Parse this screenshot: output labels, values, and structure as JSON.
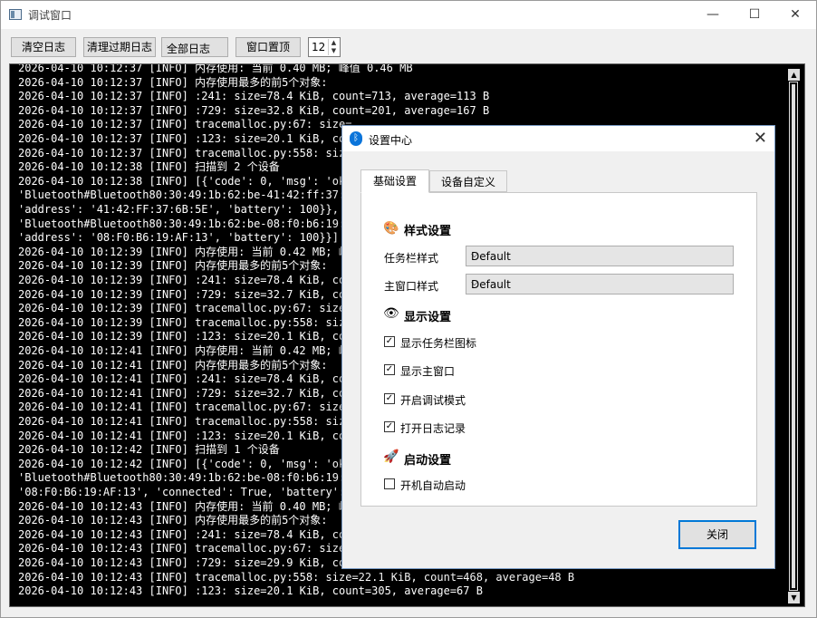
{
  "window": {
    "title": "调试窗口",
    "min": "—",
    "max": "☐",
    "close": "✕"
  },
  "toolbar": {
    "clear_log": "清空日志",
    "clear_expired": "清理过期日志",
    "filter_value": "全部日志",
    "pin_top": "窗口置顶",
    "font_size": "12"
  },
  "log": [
    "2026-04-10 10:12:37 [INFO] 内存使用: 当前 0.40 MB; 峰值 0.46 MB",
    "2026-04-10 10:12:37 [INFO] 内存使用最多的前5个对象:",
    "2026-04-10 10:12:37 [INFO] :241: size=78.4 KiB, count=713, average=113 B",
    "2026-04-10 10:12:37 [INFO] :729: size=32.8 KiB, count=201, average=167 B",
    "2026-04-10 10:12:37 [INFO] tracemalloc.py:67: size=",
    "2026-04-10 10:12:37 [INFO] :123: size=20.1 KiB, coun",
    "2026-04-10 10:12:37 [INFO] tracemalloc.py:558: size",
    "2026-04-10 10:12:38 [INFO] 扫描到 2 个设备",
    "2026-04-10 10:12:38 [INFO] [{'code': 0, 'msg': 'ok'",
    "'Bluetooth#Bluetooth80:30:49:1b:62:be-41:42:ff:37:6",
    "'address': '41:42:FF:37:6B:5E', 'battery': 100}}, {",
    "'Bluetooth#Bluetooth80:30:49:1b:62:be-08:f0:b6:19:a",
    "'address': '08:F0:B6:19:AF:13', 'battery': 100}}]",
    "2026-04-10 10:12:39 [INFO] 内存使用: 当前 0.42 MB; 峰",
    "2026-04-10 10:12:39 [INFO] 内存使用最多的前5个对象:",
    "2026-04-10 10:12:39 [INFO] :241: size=78.4 KiB, cou",
    "2026-04-10 10:12:39 [INFO] :729: size=32.7 KiB, cou",
    "2026-04-10 10:12:39 [INFO] tracemalloc.py:67: size=",
    "2026-04-10 10:12:39 [INFO] tracemalloc.py:558: size",
    "2026-04-10 10:12:39 [INFO] :123: size=20.1 KiB, cou",
    "2026-04-10 10:12:41 [INFO] 内存使用: 当前 0.42 MB; 峰",
    "2026-04-10 10:12:41 [INFO] 内存使用最多的前5个对象:",
    "2026-04-10 10:12:41 [INFO] :241: size=78.4 KiB, cou",
    "2026-04-10 10:12:41 [INFO] :729: size=32.7 KiB, cou",
    "2026-04-10 10:12:41 [INFO] tracemalloc.py:67: size=",
    "2026-04-10 10:12:41 [INFO] tracemalloc.py:558: size",
    "2026-04-10 10:12:41 [INFO] :123: size=20.1 KiB, cou",
    "2026-04-10 10:12:42 [INFO] 扫描到 1 个设备",
    "2026-04-10 10:12:42 [INFO] [{'code': 0, 'msg': 'ok'",
    "'Bluetooth#Bluetooth80:30:49:1b:62:be-08:f0:b6:19:a",
    "'08:F0:B6:19:AF:13', 'connected': True, 'battery':",
    "2026-04-10 10:12:43 [INFO] 内存使用: 当前 0.40 MB; 峰",
    "2026-04-10 10:12:43 [INFO] 内存使用最多的前5个对象:",
    "2026-04-10 10:12:43 [INFO] :241: size=78.4 KiB, cou",
    "2026-04-10 10:12:43 [INFO] tracemalloc.py:67: size=",
    "2026-04-10 10:12:43 [INFO] :729: size=29.9 KiB, cou",
    "2026-04-10 10:12:43 [INFO] tracemalloc.py:558: size=22.1 KiB, count=468, average=48 B",
    "2026-04-10 10:12:43 [INFO] :123: size=20.1 KiB, count=305, average=67 B"
  ],
  "dialog": {
    "title": "设置中心",
    "close_x": "✕",
    "tabs": [
      "基础设置",
      "设备自定义"
    ],
    "style_section": "样式设置",
    "taskbar_style_label": "任务栏样式",
    "taskbar_style_value": "Default",
    "main_style_label": "主窗口样式",
    "main_style_value": "Default",
    "display_section": "显示设置",
    "checkboxes": [
      {
        "label": "显示任务栏图标",
        "checked": true
      },
      {
        "label": "显示主窗口",
        "checked": true
      },
      {
        "label": "开启调试模式",
        "checked": true
      },
      {
        "label": "打开日志记录",
        "checked": true
      }
    ],
    "startup_section": "启动设置",
    "autostart_label": "开机自动启动",
    "autostart_checked": false,
    "close_button": "关闭"
  },
  "icons": {
    "palette": "🎨",
    "eye": "👁",
    "rocket": "🚀",
    "bluetooth": "ᛒ",
    "check": "✓"
  }
}
